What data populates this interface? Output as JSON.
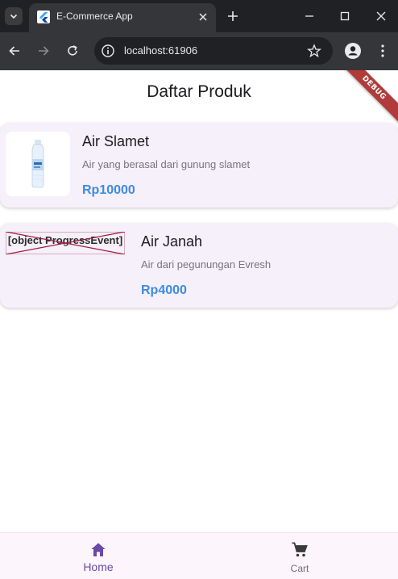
{
  "browser": {
    "tab_title": "E-Commerce App",
    "url": "localhost:61906"
  },
  "app": {
    "title": "Daftar Produk",
    "debug_banner": "DEBUG",
    "products": [
      {
        "name": "Air Slamet",
        "description": "Air yang berasal dari gunung slamet",
        "price": "Rp10000",
        "image": "water-bottle"
      },
      {
        "name": "Air Janah",
        "description": "Air dari pegunungan Evresh",
        "price": "Rp4000",
        "image_error_text": "[object ProgressEvent]"
      }
    ],
    "bottom_nav": [
      {
        "label": "Home",
        "icon": "home-icon",
        "selected": true
      },
      {
        "label": "Cart",
        "icon": "cart-icon",
        "selected": false
      }
    ]
  },
  "colors": {
    "accent": "#6a4aa5",
    "price": "#3d8be0",
    "card_bg": "#f5f0f9",
    "chrome_dark": "#202124",
    "chrome_toolbar": "#35363a"
  }
}
